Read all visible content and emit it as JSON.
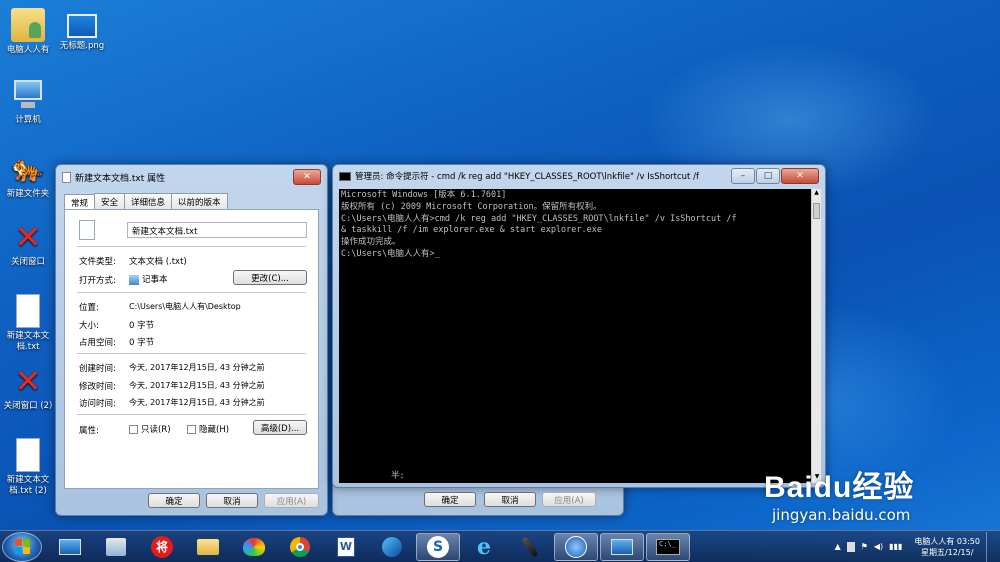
{
  "desktop": {
    "icons": [
      {
        "label": "电脑人人有",
        "icon": "user-folder-icon"
      },
      {
        "label": "无标题.png",
        "icon": "image-file-icon"
      },
      {
        "label": "计算机",
        "icon": "computer-icon"
      },
      {
        "label": "新建文件夹",
        "icon": "tiger-icon"
      },
      {
        "label": "关闭窗口",
        "icon": "red-x-icon"
      },
      {
        "label": "新建文本文档.txt",
        "icon": "text-file-icon"
      },
      {
        "label": "关闭窗口 (2)",
        "icon": "red-x-icon"
      },
      {
        "label": "新建文本文档.txt (2)",
        "icon": "text-file-icon"
      }
    ]
  },
  "props": {
    "title": "新建文本文档.txt 属性",
    "tabs": [
      "常规",
      "安全",
      "详细信息",
      "以前的版本"
    ],
    "filename": "新建文本文档.txt",
    "rows": [
      {
        "label": "文件类型:",
        "value": "文本文档 (.txt)"
      },
      {
        "label": "打开方式:",
        "value": "记事本"
      },
      {
        "label": "位置:",
        "value": "C:\\Users\\电脑人人有\\Desktop"
      },
      {
        "label": "大小:",
        "value": "0 字节"
      },
      {
        "label": "占用空间:",
        "value": "0 字节"
      },
      {
        "label": "创建时间:",
        "value": "今天, 2017年12月15日, 43 分钟之前"
      },
      {
        "label": "修改时间:",
        "value": "今天, 2017年12月15日, 43 分钟之前"
      },
      {
        "label": "访问时间:",
        "value": "今天, 2017年12月15日, 43 分钟之前"
      },
      {
        "label": "属性:",
        "value": ""
      }
    ],
    "change_btn": "更改(C)...",
    "readonly": "只读(R)",
    "hidden": "隐藏(H)",
    "advanced_btn": "高级(D)...",
    "ok": "确定",
    "cancel": "取消",
    "apply": "应用(A)"
  },
  "cmd": {
    "title": "管理员: 命令提示符 - cmd  /k reg add \"HKEY_CLASSES_ROOT\\lnkfile\" /v IsShortcut /f",
    "lines": [
      "Microsoft Windows [版本 6.1.7601]",
      "版权所有 (c) 2009 Microsoft Corporation。保留所有权利。",
      "",
      "C:\\Users\\电脑人人有>cmd /k reg add \"HKEY_CLASSES_ROOT\\lnkfile\" /v IsShortcut /f",
      "& taskkill /f /im explorer.exe & start explorer.exe",
      "操作成功完成。",
      "",
      "C:\\Users\\电脑人人有>_"
    ],
    "ime": "半:"
  },
  "behind": {
    "ok": "确定",
    "cancel": "取消",
    "apply": "应用(A)"
  },
  "taskbar": {
    "items": [
      "desktop-icon",
      "control-panel-icon",
      "chess-icon",
      "folder-icon",
      "paint-icon",
      "chrome-icon",
      "word-icon",
      "edge-icon",
      "sogou-icon",
      "ie-icon",
      "microphone-icon",
      "media-icon",
      "monitor-icon",
      "cmd-icon"
    ],
    "clock_user": "电脑人人有 03:50",
    "clock_date": "星期五/12/15/"
  },
  "watermark": {
    "brand": "Baidu经验",
    "url": "jingyan.baidu.com"
  }
}
